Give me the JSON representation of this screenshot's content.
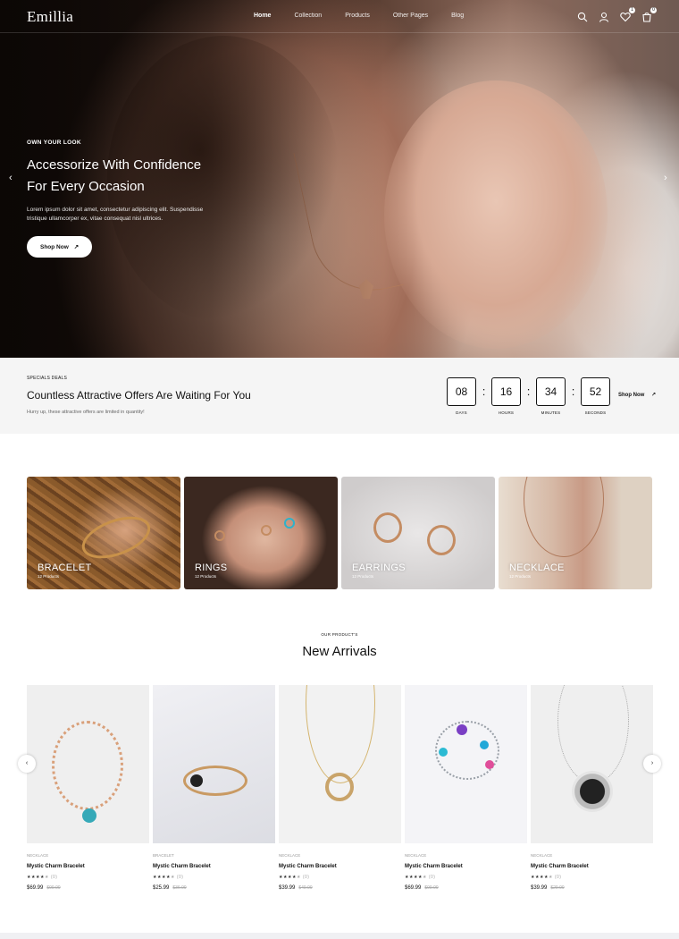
{
  "brand": "Emillia",
  "nav": {
    "items": [
      "Home",
      "Collection",
      "Products",
      "Other Pages",
      "Blog"
    ],
    "active": "Home",
    "wishlist_count": "1",
    "cart_count": "0"
  },
  "hero": {
    "eyebrow": "OWN YOUR LOOK",
    "title_line1": "Accessorize With Confidence",
    "title_line2": "For Every Occasion",
    "text": "Lorem ipsum dolor sit amet, consectetur adipiscing elit. Suspendisse tristique ullamcorper ex, vitae consequat nisl ultrices.",
    "button": "Shop Now",
    "prev": "‹",
    "next": "›"
  },
  "deals": {
    "tag": "SPECIALS DEALS",
    "title": "Countless Attractive Offers Are Waiting For You",
    "subtitle": "Hurry up, these attractive offers are limited in quantity!",
    "timer": [
      {
        "value": "08",
        "label": "DAYS"
      },
      {
        "value": "16",
        "label": "HOURS"
      },
      {
        "value": "34",
        "label": "MINUTES"
      },
      {
        "value": "52",
        "label": "SECONDS"
      }
    ],
    "shop": "Shop Now"
  },
  "categories": [
    {
      "name": "BRACELET",
      "count": "12 Products"
    },
    {
      "name": "RINGS",
      "count": "12 Products"
    },
    {
      "name": "EARRINGS",
      "count": "12 Products"
    },
    {
      "name": "NECKLACE",
      "count": "12 Products"
    }
  ],
  "arrivals": {
    "eyebrow": "OUR PRODUCT'S",
    "title": "New Arrivals",
    "products": [
      {
        "category": "NECKLACE",
        "name": "Mystic Charm Bracelet",
        "reviews": "(0)",
        "price": "$69.99",
        "old": "$99.99"
      },
      {
        "category": "BRACELET",
        "name": "Mystic Charm Bracelet",
        "reviews": "(0)",
        "price": "$25.99",
        "old": "$36.99"
      },
      {
        "category": "NECKLACE",
        "name": "Mystic Charm Bracelet",
        "reviews": "(0)",
        "price": "$39.99",
        "old": "$49.99"
      },
      {
        "category": "NECKLACE",
        "name": "Mystic Charm Bracelet",
        "reviews": "(0)",
        "price": "$69.99",
        "old": "$99.99"
      },
      {
        "category": "NECKLACE",
        "name": "Mystic Charm Bracelet",
        "reviews": "(0)",
        "price": "$39.99",
        "old": "$29.99"
      }
    ],
    "rating_stars": 4
  }
}
